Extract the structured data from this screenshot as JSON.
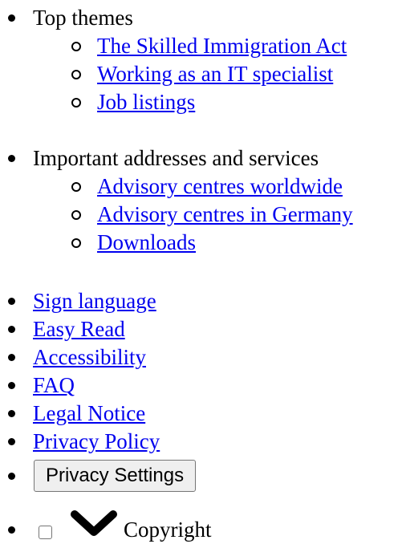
{
  "groups": [
    {
      "title": "Top themes",
      "links": [
        "The Skilled Immigration Act",
        "Working as an IT specialist",
        "Job listings"
      ]
    },
    {
      "title": "Important addresses and services",
      "links": [
        "Advisory centres worldwide",
        "Advisory centres in Germany",
        "Downloads"
      ]
    }
  ],
  "footer_links": [
    "Sign language",
    "Easy Read",
    "Accessibility",
    "FAQ",
    "Legal Notice",
    "Privacy Policy"
  ],
  "privacy_settings_label": "Privacy Settings",
  "copyright_label": "Copyright",
  "icons": {
    "toggle": "chevron-down-icon"
  },
  "colors": {
    "link": "#0000ee",
    "text": "#000000"
  }
}
